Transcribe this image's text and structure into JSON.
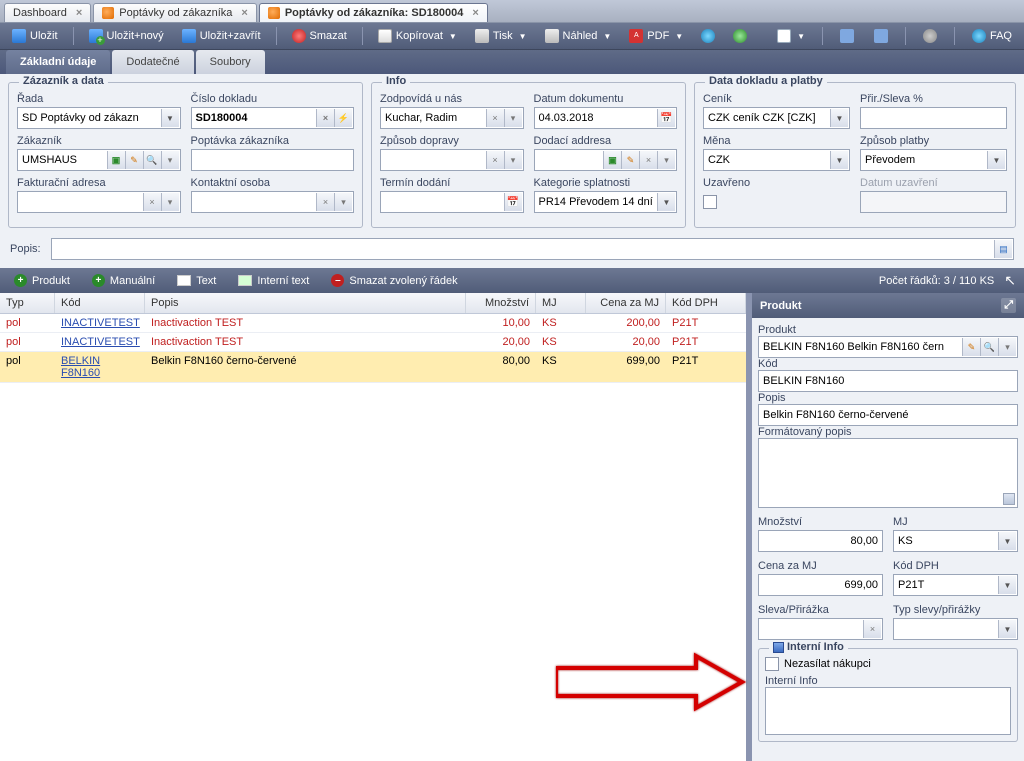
{
  "tabs": {
    "dashboard": "Dashboard",
    "list": "Poptávky od zákazníka",
    "detail": "Poptávky od zákazníka: SD180004"
  },
  "toolbar": {
    "save": "Uložit",
    "savenew": "Uložit+nový",
    "saveclose": "Uložit+zavřít",
    "delete": "Smazat",
    "copy": "Kopírovat",
    "print": "Tisk",
    "preview": "Náhled",
    "pdf": "PDF",
    "faq": "FAQ"
  },
  "subtabs": {
    "main": "Základní údaje",
    "extra": "Dodatečné",
    "files": "Soubory"
  },
  "fs1": {
    "legend": "Zázazník a data",
    "rada_l": "Řada",
    "rada_v": "SD Poptávky od zákazn",
    "cislo_l": "Číslo dokladu",
    "cislo_v": "SD180004",
    "zak_l": "Zákazník",
    "zak_v": "UMSHAUS",
    "popz_l": "Poptávka zákazníka",
    "popz_v": "",
    "fadd_l": "Fakturační adresa",
    "fadd_v": "",
    "kont_l": "Kontaktní osoba",
    "kont_v": ""
  },
  "fs2": {
    "legend": "Info",
    "zodp_l": "Zodpovídá u nás",
    "zodp_v": "Kuchar, Radim",
    "ddok_l": "Datum dokumentu",
    "ddok_v": "04.03.2018",
    "zdop_l": "Způsob dopravy",
    "zdop_v": "",
    "dadd_l": "Dodací addresa",
    "dadd_v": "",
    "tdod_l": "Termín dodání",
    "tdod_v": "",
    "kspl_l": "Kategorie splatnosti",
    "kspl_v": "PR14 Převodem 14 dní"
  },
  "fs3": {
    "legend": "Data dokladu a platby",
    "cenik_l": "Ceník",
    "cenik_v": "CZK ceník CZK [CZK]",
    "prir_l": "Přir./Sleva %",
    "prir_v": "",
    "mena_l": "Měna",
    "mena_v": "CZK",
    "zpl_l": "Způsob platby",
    "zpl_v": "Převodem",
    "uzav_l": "Uzavřeno",
    "duzav_l": "Datum uzavření"
  },
  "popis_l": "Popis:",
  "linesbar": {
    "produkt": "Produkt",
    "manual": "Manuální",
    "text": "Text",
    "itext": "Interní text",
    "del": "Smazat zvolený řádek",
    "count": "Počet řádků: 3  /  110 KS"
  },
  "cols": {
    "typ": "Typ",
    "kod": "Kód",
    "popis": "Popis",
    "mn": "Množství",
    "mj": "MJ",
    "cena": "Cena za MJ",
    "dph": "Kód DPH"
  },
  "rows": [
    {
      "typ": "pol",
      "kod": "INACTIVETEST",
      "popis": "Inactivaction TEST",
      "mn": "10,00",
      "mj": "KS",
      "cena": "200,00",
      "dph": "P21T",
      "cls": "red"
    },
    {
      "typ": "pol",
      "kod": "INACTIVETEST",
      "popis": "Inactivaction TEST",
      "mn": "20,00",
      "mj": "KS",
      "cena": "20,00",
      "dph": "P21T",
      "cls": "red"
    },
    {
      "typ": "pol",
      "kod": "BELKIN F8N160",
      "popis": "Belkin F8N160 černo-červené",
      "mn": "80,00",
      "mj": "KS",
      "cena": "699,00",
      "dph": "P21T",
      "cls": "sel"
    }
  ],
  "detail": {
    "title": "Produkt",
    "prod_l": "Produkt",
    "prod_v": "BELKIN F8N160 Belkin F8N160 čern",
    "kod_l": "Kód",
    "kod_v": "BELKIN F8N160",
    "popis_l": "Popis",
    "popis_v": "Belkin F8N160 černo-červené",
    "fpop_l": "Formátovaný popis",
    "mn_l": "Množství",
    "mn_v": "80,00",
    "mj_l": "MJ",
    "mj_v": "KS",
    "cena_l": "Cena za MJ",
    "cena_v": "699,00",
    "dph_l": "Kód DPH",
    "dph_v": "P21T",
    "sleva_l": "Sleva/Přirážka",
    "sleva_v": "",
    "typsl_l": "Typ slevy/přirážky",
    "typsl_v": "",
    "ii_legend": "Interní Info",
    "nezas": "Nezasílat nákupci",
    "ii_l": "Interní Info"
  }
}
